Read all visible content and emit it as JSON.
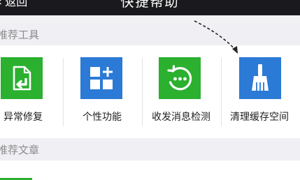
{
  "header": {
    "back_label": "返回",
    "back_chevron": "‹",
    "title": "快捷帮助",
    "more_glyph": "•••"
  },
  "sections": {
    "recommended_tools": "推荐工具",
    "recommended_articles": "推荐文章"
  },
  "tools": [
    {
      "label": "异常修复",
      "icon": "repair-document-icon",
      "color": "#2bb02f"
    },
    {
      "label": "个性功能",
      "icon": "feature-grid-icon",
      "color": "#2b7ad6"
    },
    {
      "label": "收发消息检测",
      "icon": "message-check-icon",
      "color": "#2bb02f"
    },
    {
      "label": "清理缓存空间",
      "icon": "broom-icon",
      "color": "#2b7ad6"
    }
  ],
  "colors": {
    "titlebar": "#1a1a1e",
    "green": "#2bb02f",
    "blue": "#2b7ad6",
    "background": "#efeff4"
  }
}
